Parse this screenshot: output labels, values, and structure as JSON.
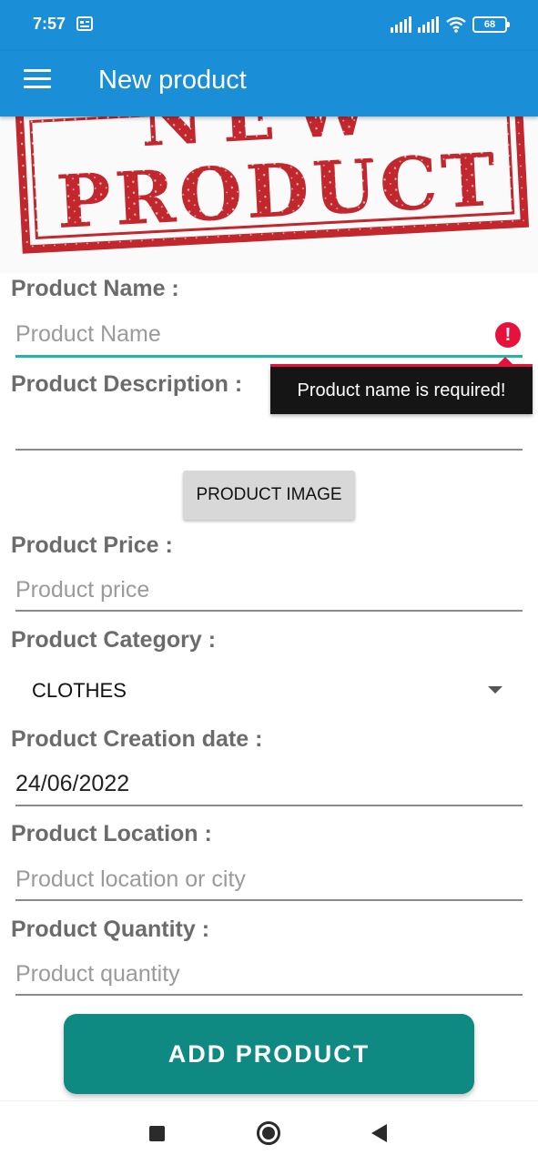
{
  "status_bar": {
    "time": "7:57",
    "battery": "68",
    "icons": [
      "sim-card-icon",
      "signal-icon",
      "signal-icon",
      "wifi-icon",
      "battery-icon"
    ]
  },
  "app_bar": {
    "title": "New product",
    "menu_icon": "hamburger-menu-icon"
  },
  "banner": {
    "stamp_text": "NEW PRODUCT",
    "color": "#c1272d"
  },
  "form": {
    "name": {
      "label": "Product Name :",
      "placeholder": "Product Name",
      "value": "",
      "error": "Product name is required!"
    },
    "description": {
      "label": "Product Description :",
      "placeholder": "",
      "value": ""
    },
    "image_button": "PRODUCT IMAGE",
    "price": {
      "label": "Product Price :",
      "placeholder": "Product price"
    },
    "category": {
      "label": "Product Category :",
      "selected": "CLOTHES"
    },
    "creation_date": {
      "label": "Product Creation date :",
      "value": "24/06/2022"
    },
    "location": {
      "label": "Product Location :",
      "placeholder": "Product location or city"
    },
    "quantity": {
      "label": "Product Quantity :",
      "placeholder": "Product quantity"
    },
    "submit_label": "ADD PRODUCT"
  },
  "nav_bar": {
    "icons": [
      "recents-icon",
      "home-icon",
      "back-icon"
    ]
  },
  "colors": {
    "app_bar": "#1a8ed6",
    "accent": "#1fb5a9",
    "error": "#e8113c",
    "submit": "#0f8a82"
  }
}
